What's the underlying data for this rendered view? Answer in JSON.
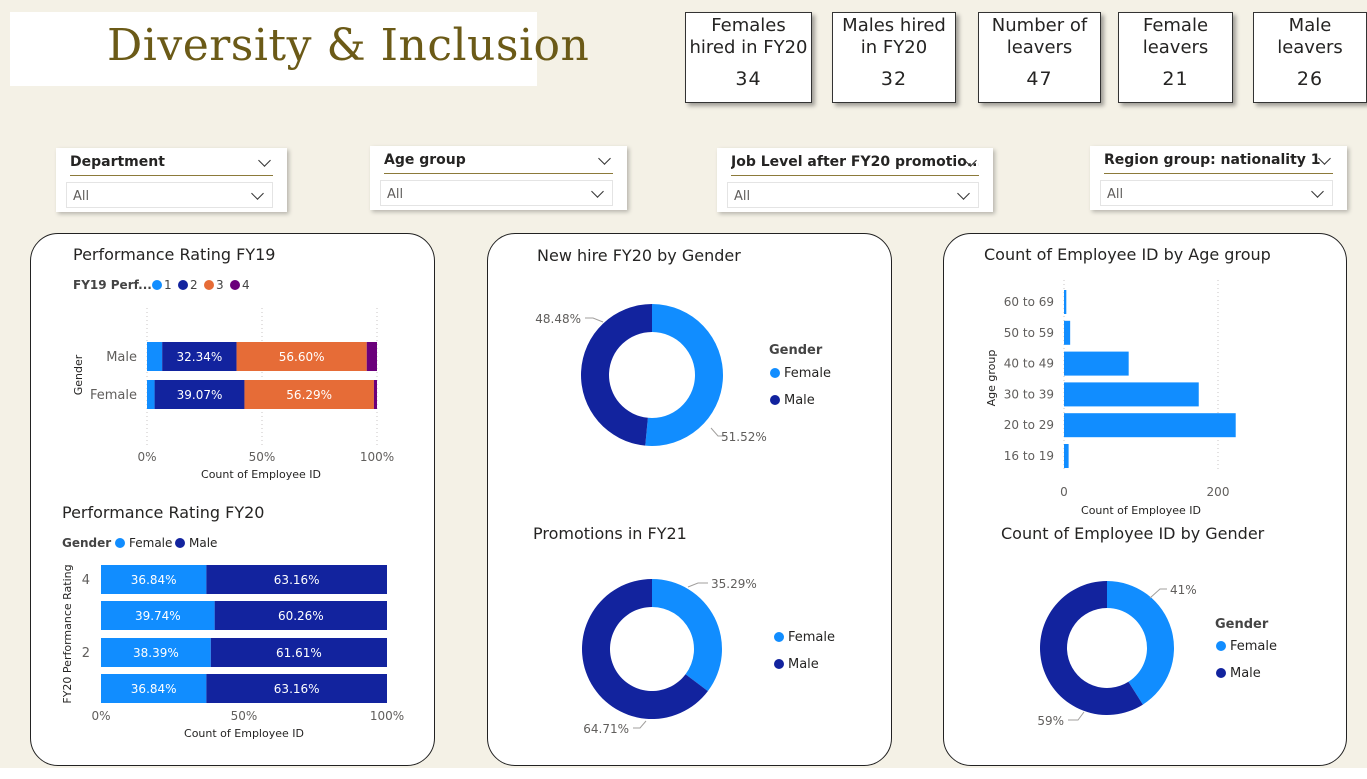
{
  "title": "Diversity & Inclusion",
  "kpis": [
    {
      "label": "Females\nhired in FY20",
      "value": "34"
    },
    {
      "label": "Males hired\nin FY20",
      "value": "32"
    },
    {
      "label": "Number of\nleavers",
      "value": "47"
    },
    {
      "label": "Female\nleavers",
      "value": "21"
    },
    {
      "label": "Male\nleavers",
      "value": "26"
    }
  ],
  "slicers": [
    {
      "label": "Department",
      "value": "All"
    },
    {
      "label": "Age group",
      "value": "All"
    },
    {
      "label": "Job Level after FY20 promotio...",
      "value": "All"
    },
    {
      "label": "Region group: nationality 1",
      "value": "All"
    }
  ],
  "colors": {
    "light_blue": "#118dff",
    "dark_blue": "#12239e",
    "orange": "#e66c37",
    "purple": "#6b007b",
    "title_gold": "#6b5a17"
  },
  "chart_data": [
    {
      "id": "perf_fy19",
      "type": "bar",
      "orientation": "horizontal",
      "stacked": "100%",
      "title": "Performance Rating FY19",
      "legend_title": "FY19 Perf...",
      "xlabel": "Count of Employee ID",
      "ylabel": "Gender",
      "x_ticks": [
        "0%",
        "50%",
        "100%"
      ],
      "categories": [
        "Male",
        "Female"
      ],
      "series": [
        {
          "name": "1",
          "color": "#118dff",
          "values": [
            6.6,
            3.3
          ]
        },
        {
          "name": "2",
          "color": "#12239e",
          "values": [
            32.34,
            39.07
          ],
          "labels": [
            "32.34%",
            "39.07%"
          ]
        },
        {
          "name": "3",
          "color": "#e66c37",
          "values": [
            56.6,
            56.29
          ],
          "labels": [
            "56.60%",
            "56.29%"
          ]
        },
        {
          "name": "4",
          "color": "#6b007b",
          "values": [
            4.46,
            1.34
          ]
        }
      ]
    },
    {
      "id": "perf_fy20",
      "type": "bar",
      "orientation": "horizontal",
      "stacked": "100%",
      "title": "Performance Rating FY20",
      "legend_title": "Gender",
      "xlabel": "Count of Employee ID",
      "ylabel": "FY20 Performance Rating",
      "x_ticks": [
        "0%",
        "50%",
        "100%"
      ],
      "categories": [
        "4",
        "",
        "2",
        ""
      ],
      "series": [
        {
          "name": "Female",
          "color": "#118dff",
          "values": [
            36.84,
            39.74,
            38.39,
            36.84
          ],
          "labels": [
            "36.84%",
            "39.74%",
            "38.39%",
            "36.84%"
          ]
        },
        {
          "name": "Male",
          "color": "#12239e",
          "values": [
            63.16,
            60.26,
            61.61,
            63.16
          ],
          "labels": [
            "63.16%",
            "60.26%",
            "61.61%",
            "63.16%"
          ]
        }
      ]
    },
    {
      "id": "newhire_gender",
      "type": "pie",
      "donut": true,
      "title": "New hire FY20 by Gender",
      "legend_title": "Gender",
      "slices": [
        {
          "name": "Female",
          "value": 51.52,
          "label": "51.52%",
          "color": "#118dff"
        },
        {
          "name": "Male",
          "value": 48.48,
          "label": "48.48%",
          "color": "#12239e"
        }
      ]
    },
    {
      "id": "promotions_fy21",
      "type": "pie",
      "donut": true,
      "title": "Promotions in FY21",
      "legend_title": "",
      "slices": [
        {
          "name": "Female",
          "value": 35.29,
          "label": "35.29%",
          "color": "#118dff"
        },
        {
          "name": "Male",
          "value": 64.71,
          "label": "64.71%",
          "color": "#12239e"
        }
      ]
    },
    {
      "id": "age_group",
      "type": "bar",
      "orientation": "horizontal",
      "title": "Count of Employee ID by Age group",
      "xlabel": "Count of Employee ID",
      "ylabel": "Age group",
      "xlim": [
        0,
        270
      ],
      "x_ticks": [
        0,
        200
      ],
      "categories": [
        "60 to 69",
        "50 to 59",
        "40 to 49",
        "30 to 39",
        "20 to 29",
        "16 to 19"
      ],
      "values": [
        3,
        8,
        84,
        175,
        223,
        6
      ],
      "color": "#118dff"
    },
    {
      "id": "gender_count",
      "type": "pie",
      "donut": true,
      "title": "Count of Employee ID by Gender",
      "legend_title": "Gender",
      "slices": [
        {
          "name": "Female",
          "value": 41,
          "label": "41%",
          "color": "#118dff"
        },
        {
          "name": "Male",
          "value": 59,
          "label": "59%",
          "color": "#12239e"
        }
      ]
    }
  ]
}
